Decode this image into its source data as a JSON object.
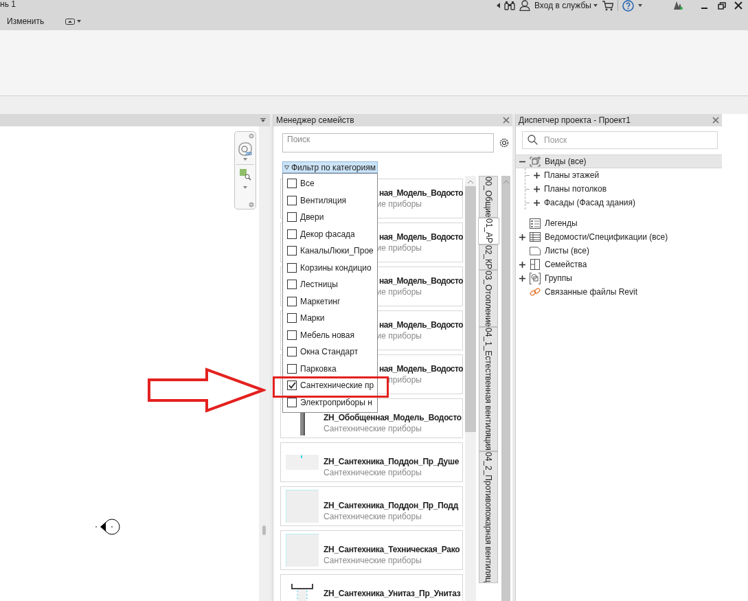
{
  "title_bar": {
    "title": "нь 1",
    "sign_in": "Вход в службы"
  },
  "navigation_bar": {
    "wheel_label": "2D"
  },
  "ribbon": {
    "tab": "Изменить"
  },
  "family_manager": {
    "title": "Менеджер семейств",
    "search": {
      "placeholder": "Поиск"
    },
    "filter_button": "Фильтр по категориям",
    "filter_options": [
      {
        "label": "Все",
        "checked": false
      },
      {
        "label": "Вентиляция",
        "checked": false
      },
      {
        "label": "Двери",
        "checked": false
      },
      {
        "label": "Декор фасада",
        "checked": false
      },
      {
        "label": "КаналыЛюки_Прое",
        "checked": false
      },
      {
        "label": "Корзины кондицио",
        "checked": false
      },
      {
        "label": "Лестницы",
        "checked": false
      },
      {
        "label": "Маркетинг",
        "checked": false
      },
      {
        "label": "Марки",
        "checked": false
      },
      {
        "label": "Мебель новая",
        "checked": false
      },
      {
        "label": "Окна Стандарт",
        "checked": false
      },
      {
        "label": "Парковка",
        "checked": false
      },
      {
        "label": "Сантехнические пр",
        "checked": true
      },
      {
        "label": "Электроприборы н",
        "checked": false
      }
    ],
    "families": [
      {
        "title": "ная_Модель_Водосто",
        "subtitle": "ие приборы",
        "kind": "covered"
      },
      {
        "title": "ная_Модель_Водосто",
        "subtitle": "ие приборы",
        "kind": "covered"
      },
      {
        "title": "ная_Модель_Водосто",
        "subtitle": "ие приборы",
        "kind": "covered"
      },
      {
        "title": "ная_Модель_Водосто",
        "subtitle": "ие приборы",
        "kind": "covered"
      },
      {
        "title": "ная_Модель_Водосто",
        "subtitle": "приборы",
        "kind": "covered"
      },
      {
        "title": "ZH_Обобщенная_Модель_Водосто",
        "subtitle": "Сантехнические приборы",
        "kind": "pipe"
      },
      {
        "title": "ZH_Сантехника_Поддон_Пр_Душе",
        "subtitle": "Сантехнические приборы",
        "kind": "tray"
      },
      {
        "title": "ZH_Сантехника_Поддон_Пр_Подд",
        "subtitle": "Сантехнические приборы",
        "kind": "panel"
      },
      {
        "title": "ZH_Сантехника_Техническая_Рако",
        "subtitle": "Сантехнические приборы",
        "kind": "panel"
      },
      {
        "title": "ZH_Сантехника_Унитаз_Пр_Унитаз",
        "kind": "toilet"
      }
    ],
    "tabs": [
      {
        "label": "00_Общие",
        "selected": false
      },
      {
        "label": "01_АР",
        "selected": true
      },
      {
        "label": "02_КР",
        "selected": false
      },
      {
        "label": "03_Отопление",
        "selected": false
      },
      {
        "label": "04_1_Естественная вентиляция",
        "selected": false
      },
      {
        "label": "04_2_Противопожарная вентиляц",
        "selected": false
      }
    ]
  },
  "project_browser": {
    "title": "Диспетчер проекта - Проект1",
    "search": {
      "placeholder": "Поиск"
    },
    "tree": [
      {
        "label": "Виды (все)",
        "kind": "views",
        "expanded": true,
        "selected": true,
        "children": [
          {
            "label": "Планы этажей",
            "expanded": false,
            "selected": false
          },
          {
            "label": "Планы потолков",
            "expanded": false,
            "selected": false
          },
          {
            "label": "Фасады (Фасад здания)",
            "expanded": false,
            "selected": false
          }
        ]
      },
      {
        "label": "Легенды",
        "kind": "legend",
        "selected": false
      },
      {
        "label": "Ведомости/Спецификации (все)",
        "kind": "schedule",
        "expanded": false,
        "selected": false
      },
      {
        "label": "Листы (все)",
        "kind": "sheet",
        "selected": false
      },
      {
        "label": "Семейства",
        "kind": "families",
        "expanded": false,
        "selected": false
      },
      {
        "label": "Группы",
        "kind": "groups",
        "expanded": false,
        "selected": false
      },
      {
        "label": "Связанные файлы Revit",
        "kind": "link",
        "selected": false
      }
    ]
  }
}
